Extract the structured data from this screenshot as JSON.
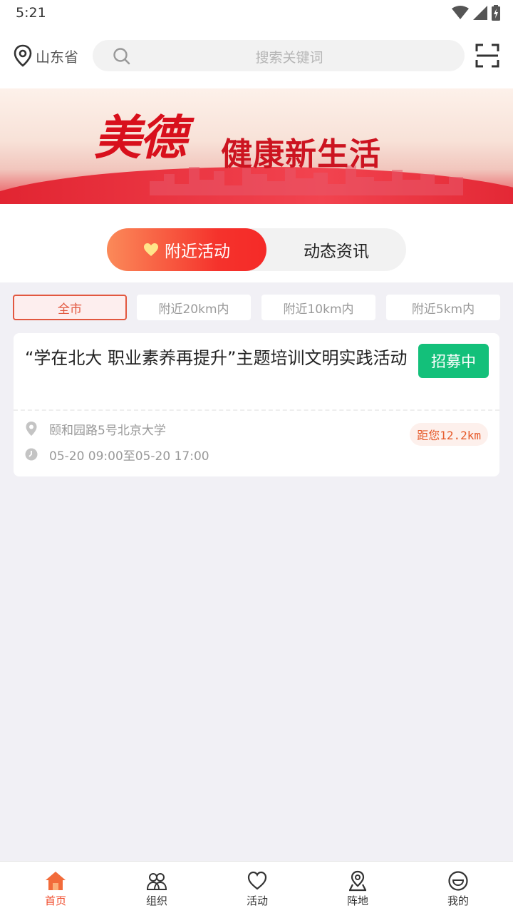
{
  "status_bar": {
    "time": "5:21",
    "icons": [
      "wifi-icon",
      "signal-icon",
      "battery-icon"
    ]
  },
  "header": {
    "location": "山东省",
    "search_placeholder": "搜索关键词",
    "icons": [
      "location-pin-icon",
      "search-icon",
      "scan-icon"
    ]
  },
  "banner": {
    "title_main": "美德",
    "title_sub": "健康新生活"
  },
  "tabs": [
    {
      "label": "附近活动",
      "active": true,
      "icon": "heart-icon"
    },
    {
      "label": "动态资讯",
      "active": false
    }
  ],
  "filters": [
    {
      "label": "全市",
      "active": true
    },
    {
      "label": "附近20km内",
      "active": false
    },
    {
      "label": "附近10km内",
      "active": false
    },
    {
      "label": "附近5km内",
      "active": false
    }
  ],
  "activities": [
    {
      "title": "“学在北大  职业素养再提升”主题培训文明实践活动",
      "status": "招募中",
      "address": "颐和园路5号北京大学",
      "time": "05-20  09:00至05-20  17:00",
      "distance": "距您12.2km"
    }
  ],
  "bottom_nav": [
    {
      "label": "首页",
      "icon": "home-icon",
      "active": true
    },
    {
      "label": "组织",
      "icon": "group-icon",
      "active": false
    },
    {
      "label": "活动",
      "icon": "heart-outline-icon",
      "active": false
    },
    {
      "label": "阵地",
      "icon": "map-pin-icon",
      "active": false
    },
    {
      "label": "我的",
      "icon": "smile-icon",
      "active": false
    }
  ],
  "colors": {
    "accent": "#f04a2a",
    "badge_green": "#13c07a",
    "tab_gradient_start": "#fb8a59",
    "tab_gradient_end": "#f52a28"
  }
}
